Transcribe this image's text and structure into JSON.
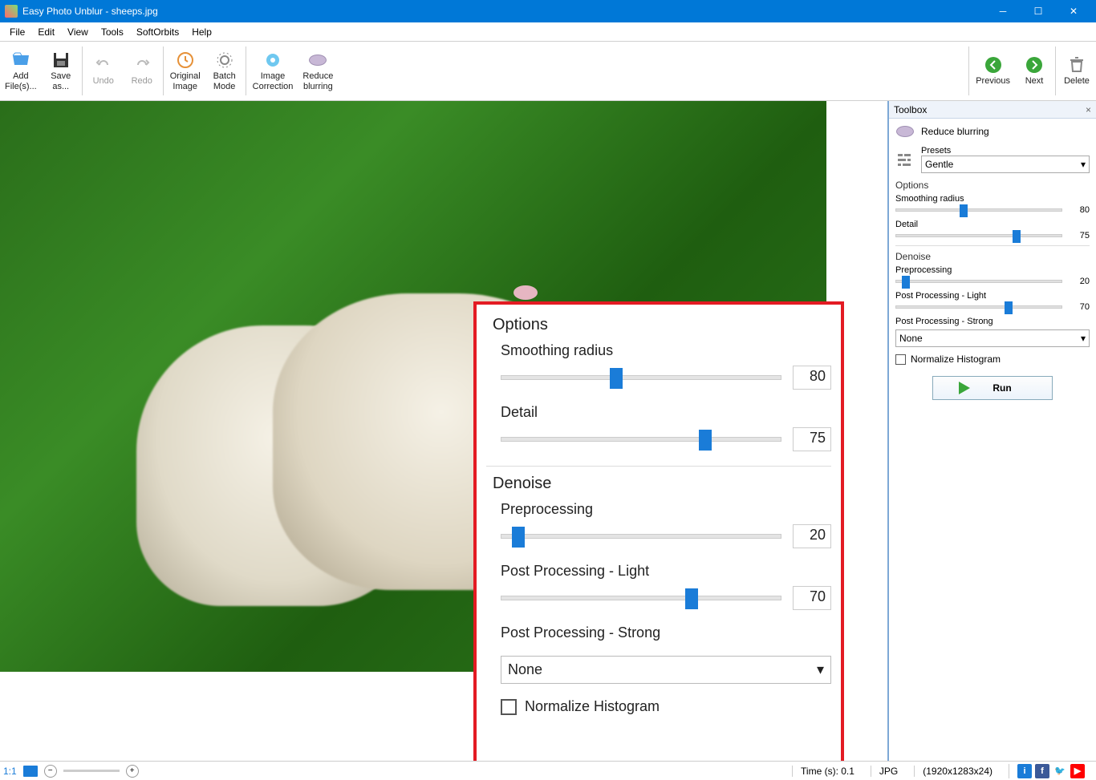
{
  "titlebar": {
    "title": "Easy Photo Unblur - sheeps.jpg"
  },
  "menu": {
    "file": "File",
    "edit": "Edit",
    "view": "View",
    "tools": "Tools",
    "softorbits": "SoftOrbits",
    "help": "Help"
  },
  "toolbar": {
    "add": "Add\nFile(s)...",
    "save_as": "Save\nas...",
    "undo": "Undo",
    "redo": "Redo",
    "original": "Original\nImage",
    "batch": "Batch\nMode",
    "correction": "Image\nCorrection",
    "reduce": "Reduce\nblurring",
    "previous": "Previous",
    "next": "Next",
    "delete": "Delete"
  },
  "toolbox": {
    "panel_title": "Toolbox",
    "mode_label": "Reduce blurring",
    "presets_label": "Presets",
    "presets_value": "Gentle",
    "options_label": "Options",
    "smoothing_label": "Smoothing radius",
    "smoothing_value": "80",
    "detail_label": "Detail",
    "detail_value": "75",
    "denoise_label": "Denoise",
    "preproc_label": "Preprocessing",
    "preproc_value": "20",
    "postlight_label": "Post Processing - Light",
    "postlight_value": "70",
    "poststrong_label": "Post Processing - Strong",
    "poststrong_value": "None",
    "normalize_label": "Normalize Histogram",
    "run_label": "Run"
  },
  "popup": {
    "options_title": "Options",
    "smoothing_label": "Smoothing radius",
    "smoothing_value": "80",
    "detail_label": "Detail",
    "detail_value": "75",
    "denoise_title": "Denoise",
    "preproc_label": "Preprocessing",
    "preproc_value": "20",
    "postlight_label": "Post Processing - Light",
    "postlight_value": "70",
    "poststrong_label": "Post Processing - Strong",
    "poststrong_value": "None",
    "normalize_label": "Normalize Histogram"
  },
  "statusbar": {
    "zoom_label": "1:1",
    "time_label": "Time (s): 0.1",
    "format_label": "JPG",
    "dim_label": "(1920x1283x24)"
  }
}
